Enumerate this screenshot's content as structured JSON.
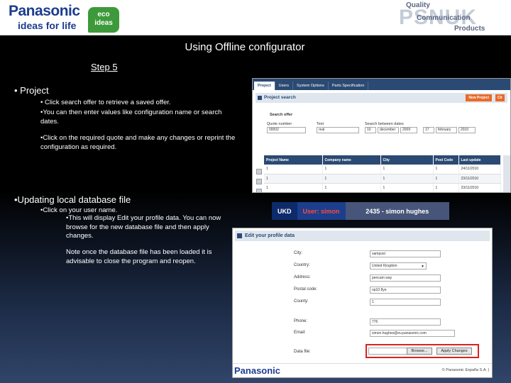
{
  "header": {
    "logo": "Panasonic",
    "tagline": "ideas for life",
    "eco_badge": [
      "eco",
      "ideas"
    ],
    "psnuk_big": "PSNUK",
    "psnuk_quality": "Quality",
    "psnuk_communication": "Communication",
    "psnuk_products": "Products"
  },
  "slide": {
    "title": "Using Offline configurator",
    "subtitle": "Step 5",
    "project_heading": "• Project",
    "project_bullet1": "• Click search offer to retrieve a saved offer.",
    "project_bullet2": "•You can then enter values like configuration name or search dates.",
    "project_bullet3": "•Click on the required quote and make any changes or reprint the configuration as required.",
    "update_heading": "•Updating local database file",
    "update_bullet1": "•Click on your user name.",
    "update_bullet2": "•This will display Edit your profile data. You can now browse for the new database file and then apply changes.",
    "update_note": "Note once the database file has been loaded it is advisable to close the program and reopen."
  },
  "project_search": {
    "tabs": [
      "Project",
      "Users",
      "System Options",
      "Parts Specification"
    ],
    "active_tab": 0,
    "panel_title": "Project search",
    "new_button": "New Project",
    "clear_button": "Clr",
    "section_label": "Search offer",
    "quote_label": "Quote number",
    "quote_value": "00002",
    "text_label": "Text",
    "text_value": "real",
    "dates_label": "Search between dates",
    "date_from": [
      "10",
      "december",
      "2009"
    ],
    "date_to": [
      "17",
      "february",
      "2010"
    ],
    "columns": [
      "Project Name",
      "Company name",
      "City",
      "Post Code",
      "Last update"
    ],
    "rows": [
      [
        "1",
        "1",
        "1",
        "1",
        "24/11/2010"
      ],
      [
        "1",
        "1",
        "1",
        "1",
        "23/11/2010"
      ],
      [
        "1",
        "1",
        "1",
        "1",
        "23/11/2010"
      ]
    ]
  },
  "user_bar": {
    "site": "UKD",
    "user_label": "User:",
    "user_name": "simon",
    "account": "2435 - simon hughes"
  },
  "profile": {
    "panel_title": "Edit your profile data",
    "fields": [
      {
        "label": "City:",
        "value": "sampost"
      },
      {
        "label": "Country:",
        "value": "United Kingdom"
      },
      {
        "label": "Address:",
        "value": "pencam way"
      },
      {
        "label": "Postal code:",
        "value": "np10 8ye"
      },
      {
        "label": "County:",
        "value": "1"
      },
      {
        "label": "Phone:",
        "value": "776"
      },
      {
        "label": "Email:",
        "value": "simon.hughes@eu.panasonic.com"
      }
    ],
    "data_file_label": "Data file:",
    "browse_button": "Browse...",
    "apply_button": "Apply Changes",
    "footer_logo": "Panasonic",
    "copyright": "© Panasonic España S.A. |"
  }
}
